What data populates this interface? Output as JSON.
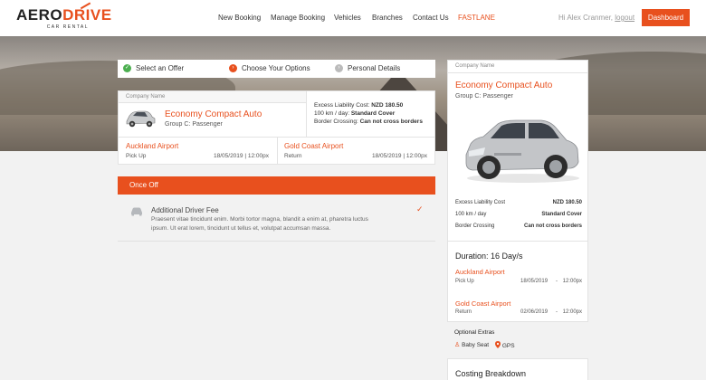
{
  "brand": {
    "name_part1": "AERO",
    "name_part2": "DRIVE",
    "sub": "CAR RENTAL",
    "accent": "#e8501e"
  },
  "nav": {
    "items": [
      "New Booking",
      "Manage Booking",
      "Vehicles",
      "Branches",
      "Contact Us",
      "FASTLANE"
    ],
    "greeting": "Hi Alex Cranmer,",
    "logout": "logout",
    "dashboard": "Dashboard"
  },
  "steps": [
    {
      "label": "Select an Offer",
      "state": "done"
    },
    {
      "label": "Choose Your Options",
      "state": "current"
    },
    {
      "label": "Personal Details",
      "state": "pending"
    }
  ],
  "booking": {
    "company_label": "Company Name",
    "vehicle": "Economy Compact Auto",
    "group": "Group C: Passenger",
    "specs": [
      {
        "label": "Excess Liability Cost:",
        "value": "NZD 180.50"
      },
      {
        "label": "100 km / day:",
        "value": "Standard Cover"
      },
      {
        "label": "Border Crossing:",
        "value": "Can not cross borders"
      }
    ],
    "pickup": {
      "location": "Auckland Airport",
      "label": "Pick Up",
      "datetime": "18/05/2019 | 12:00px"
    },
    "return": {
      "location": "Gold Coast Airport",
      "label": "Return",
      "datetime": "18/05/2019 | 12:00px"
    }
  },
  "once_off": {
    "header": "Once Off",
    "fee_title": "Additional Driver Fee",
    "fee_desc": "Praesent vitae tincidunt enim. Morbi tortor magna, blandit a enim at, pharetra luctus ipsum. Ut erat lorem, tincidunt ut tellus et, volutpat accumsan massa."
  },
  "summary": {
    "company_label": "Company Name",
    "vehicle": "Economy Compact Auto",
    "group": "Group C: Passenger",
    "specs": [
      {
        "label": "Excess Liability Cost",
        "value": "NZD 180.50"
      },
      {
        "label": "100 km / day",
        "value": "Standard Cover"
      },
      {
        "label": "Border Crossing",
        "value": "Can not cross borders"
      }
    ],
    "duration": "Duration: 16 Day/s",
    "pickup": {
      "location": "Auckland Airport",
      "label": "Pick Up",
      "date": "18/05/2019",
      "sep": "-",
      "time": "12:00px"
    },
    "return": {
      "location": "Gold Coast Airport",
      "label": "Return",
      "date": "02/06/2019",
      "sep": "-",
      "time": "12:00px"
    },
    "optional_title": "Optional Extras",
    "optional": [
      "Baby Seat",
      "GPS"
    ],
    "costing": "Costing Breakdown"
  }
}
